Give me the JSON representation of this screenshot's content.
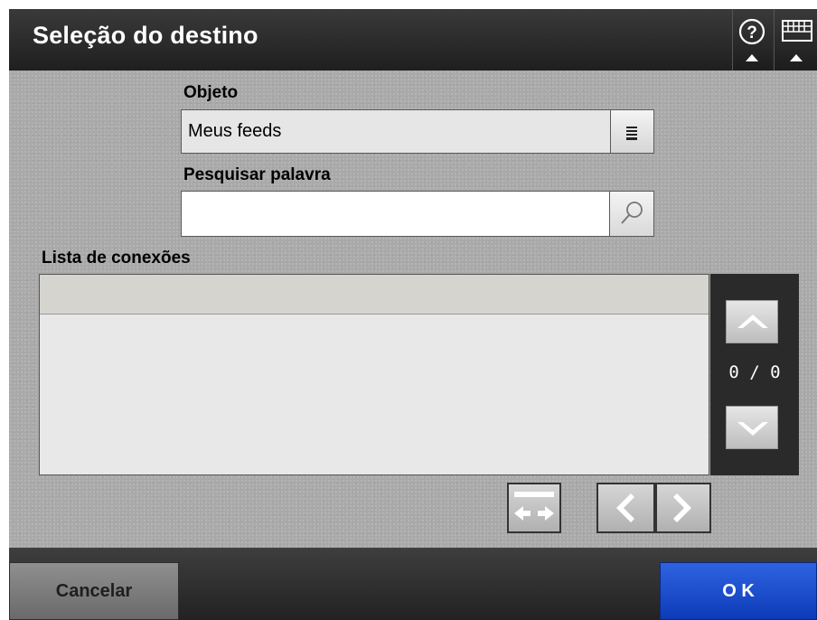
{
  "title": "Seleção do destino",
  "header": {
    "help_icon": "help-question-icon",
    "keyboard_icon": "keyboard-icon"
  },
  "object": {
    "label": "Objeto",
    "value": "Meus feeds",
    "dropdown_icon": "list-dropdown-icon"
  },
  "search": {
    "label": "Pesquisar palavra",
    "value": "",
    "placeholder": "",
    "icon": "magnifier-icon"
  },
  "connections": {
    "label": "Lista de conexões",
    "rows": [
      ""
    ],
    "page_indicator": "0 / 0"
  },
  "footer": {
    "cancel_label": "Cancelar",
    "ok_label": "O K"
  },
  "colors": {
    "ok_button": "#1a4bd0",
    "titlebar": "#2b2b2b",
    "background": "#a9a9a9"
  }
}
